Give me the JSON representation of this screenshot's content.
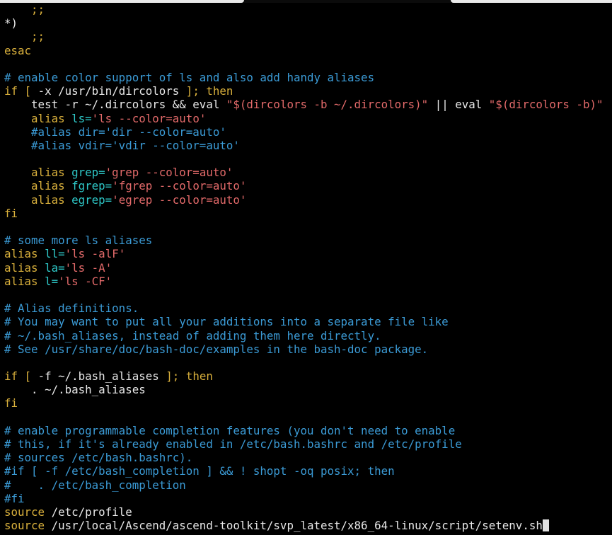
{
  "colors": {
    "background": "#000000",
    "default": "#e8e8e8",
    "comment": "#3b9bd6",
    "keyword": "#d9b03c",
    "string": "#e36a6a",
    "variable": "#2ec8c8",
    "cursor": "#e0e0e0"
  },
  "lines": [
    [
      {
        "t": "    ;;",
        "c": "keyword"
      }
    ],
    [
      {
        "t": "*)",
        "c": "default"
      }
    ],
    [
      {
        "t": "    ;;",
        "c": "keyword"
      }
    ],
    [
      {
        "t": "esac",
        "c": "keyword"
      }
    ],
    [],
    [
      {
        "t": "# enable color support of ls and also add handy aliases",
        "c": "comment"
      }
    ],
    [
      {
        "t": "if [ ",
        "c": "keyword"
      },
      {
        "t": "-x /usr/bin/dircolors",
        "c": "default"
      },
      {
        "t": " ]; then",
        "c": "keyword"
      }
    ],
    [
      {
        "t": "    test -r ~/.dircolors && eval ",
        "c": "default"
      },
      {
        "t": "\"$(dircolors -b ~/.dircolors)\"",
        "c": "string"
      },
      {
        "t": " || eval ",
        "c": "default"
      },
      {
        "t": "\"$(dircolors -b)\"",
        "c": "string"
      }
    ],
    [
      {
        "t": "    alias ",
        "c": "keyword"
      },
      {
        "t": "ls=",
        "c": "variable"
      },
      {
        "t": "'ls --color=auto'",
        "c": "string"
      }
    ],
    [
      {
        "t": "    #alias dir='dir --color=auto'",
        "c": "comment"
      }
    ],
    [
      {
        "t": "    #alias vdir='vdir --color=auto'",
        "c": "comment"
      }
    ],
    [],
    [
      {
        "t": "    alias ",
        "c": "keyword"
      },
      {
        "t": "grep=",
        "c": "variable"
      },
      {
        "t": "'grep --color=auto'",
        "c": "string"
      }
    ],
    [
      {
        "t": "    alias ",
        "c": "keyword"
      },
      {
        "t": "fgrep=",
        "c": "variable"
      },
      {
        "t": "'fgrep --color=auto'",
        "c": "string"
      }
    ],
    [
      {
        "t": "    alias ",
        "c": "keyword"
      },
      {
        "t": "egrep=",
        "c": "variable"
      },
      {
        "t": "'egrep --color=auto'",
        "c": "string"
      }
    ],
    [
      {
        "t": "fi",
        "c": "keyword"
      }
    ],
    [],
    [
      {
        "t": "# some more ls aliases",
        "c": "comment"
      }
    ],
    [
      {
        "t": "alias ",
        "c": "keyword"
      },
      {
        "t": "ll=",
        "c": "variable"
      },
      {
        "t": "'ls -alF'",
        "c": "string"
      }
    ],
    [
      {
        "t": "alias ",
        "c": "keyword"
      },
      {
        "t": "la=",
        "c": "variable"
      },
      {
        "t": "'ls -A'",
        "c": "string"
      }
    ],
    [
      {
        "t": "alias ",
        "c": "keyword"
      },
      {
        "t": "l=",
        "c": "variable"
      },
      {
        "t": "'ls -CF'",
        "c": "string"
      }
    ],
    [],
    [
      {
        "t": "# Alias definitions.",
        "c": "comment"
      }
    ],
    [
      {
        "t": "# You may want to put all your additions into a separate file like",
        "c": "comment"
      }
    ],
    [
      {
        "t": "# ~/.bash_aliases, instead of adding them here directly.",
        "c": "comment"
      }
    ],
    [
      {
        "t": "# See /usr/share/doc/bash-doc/examples in the bash-doc package.",
        "c": "comment"
      }
    ],
    [],
    [
      {
        "t": "if [ ",
        "c": "keyword"
      },
      {
        "t": "-f ~/.bash_aliases",
        "c": "default"
      },
      {
        "t": " ]; then",
        "c": "keyword"
      }
    ],
    [
      {
        "t": "    . ~/.bash_aliases",
        "c": "default"
      }
    ],
    [
      {
        "t": "fi",
        "c": "keyword"
      }
    ],
    [],
    [
      {
        "t": "# enable programmable completion features (you don't need to enable",
        "c": "comment"
      }
    ],
    [
      {
        "t": "# this, if it's already enabled in /etc/bash.bashrc and /etc/profile",
        "c": "comment"
      }
    ],
    [
      {
        "t": "# sources /etc/bash.bashrc).",
        "c": "comment"
      }
    ],
    [
      {
        "t": "#if [ -f /etc/bash_completion ] && ! shopt -oq posix; then",
        "c": "comment"
      }
    ],
    [
      {
        "t": "#    . /etc/bash_completion",
        "c": "comment"
      }
    ],
    [
      {
        "t": "#fi",
        "c": "comment"
      }
    ],
    [
      {
        "t": "source ",
        "c": "keyword"
      },
      {
        "t": "/etc/profile",
        "c": "default"
      }
    ],
    [
      {
        "t": "source ",
        "c": "keyword"
      },
      {
        "t": "/usr/local/Ascend/ascend-toolkit/svp_latest/x86_64-linux/script/setenv.sh",
        "c": "default"
      }
    ]
  ]
}
